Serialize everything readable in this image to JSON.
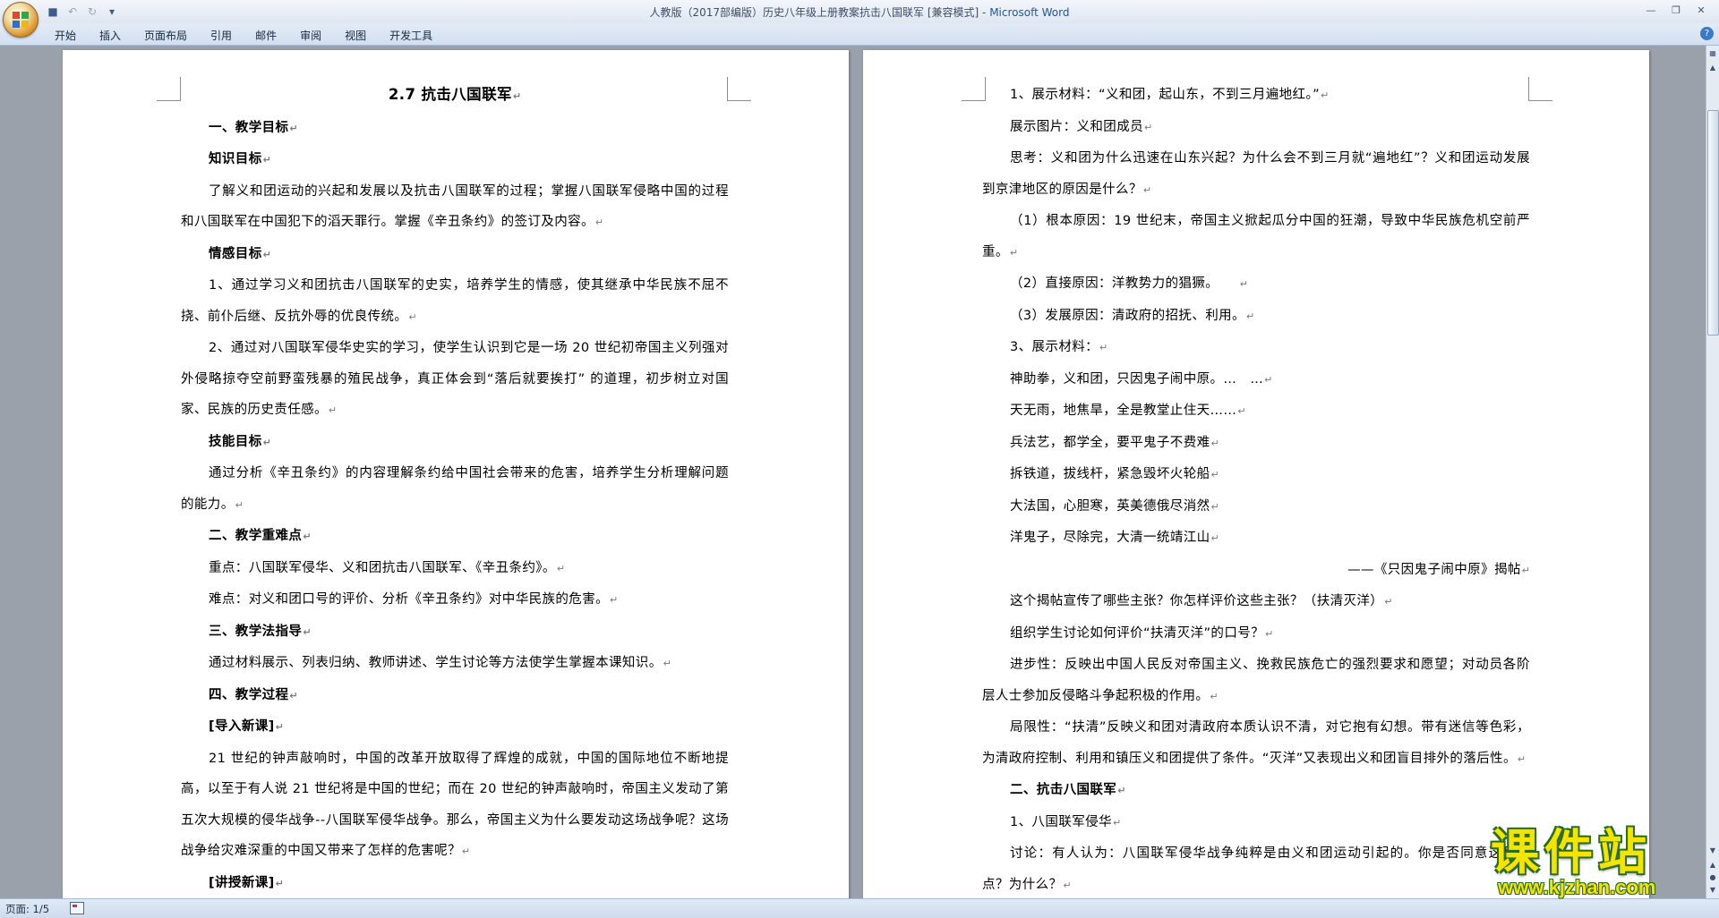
{
  "window": {
    "doc_title": "人教版（2017部编版）历史八年级上册教案抗击八国联军 [兼容模式] - ",
    "app_name": "Microsoft Word"
  },
  "ribbon": {
    "tabs": [
      "开始",
      "插入",
      "页面布局",
      "引用",
      "邮件",
      "审阅",
      "视图",
      "开发工具"
    ]
  },
  "page1": {
    "paragraphs": [
      "2.7 抗击八国联军",
      "一、教学目标",
      "知识目标",
      "了解义和团运动的兴起和发展以及抗击八国联军的过程；掌握八国联军侵略中国的过程和八国联军在中国犯下的滔天罪行。掌握《辛丑条约》的签订及内容。",
      "情感目标",
      "1、通过学习义和团抗击八国联军的史实，培养学生的情感，使其继承中华民族不屈不挠、前仆后继、反抗外辱的优良传统。",
      "2、通过对八国联军侵华史实的学习，使学生认识到它是一场 20 世纪初帝国主义列强对外侵略掠夺空前野蛮残暴的殖民战争，真正体会到“落后就要挨打” 的道理，初步树立对国家、民族的历史责任感。",
      "技能目标",
      "通过分析《辛丑条约》的内容理解条约给中国社会带来的危害，培养学生分析理解问题的能力。",
      "二、教学重难点",
      "重点：八国联军侵华、义和团抗击八国联军、《辛丑条约》。",
      "难点：对义和团口号的评价、分析《辛丑条约》对中华民族的危害。",
      "三、教学法指导",
      "通过材料展示、列表归纳、教师讲述、学生讨论等方法使学生掌握本课知识。",
      "四、教学过程",
      "[导入新课]",
      "21 世纪的钟声敲响时，中国的改革开放取得了辉煌的成就，中国的国际地位不断地提高，以至于有人说 21 世纪将是中国的世纪；而在 20 世纪的钟声敲响时，帝国主义发动了第五次大规模的侵华战争--八国联军侵华战争。那么，帝国主义为什么要发动这场战争呢？这场战争给灾难深重的中国又带来了怎样的危害呢？",
      "[讲授新课]"
    ]
  },
  "page2": {
    "paragraphs": [
      "1、展示材料：“义和团，起山东，不到三月遍地红。”",
      "展示图片：义和团成员",
      "思考：义和团为什么迅速在山东兴起？为什么会不到三月就“遍地红”？义和团运动发展到京津地区的原因是什么？",
      "（1）根本原因：19 世纪末，帝国主义掀起瓜分中国的狂潮，导致中华民族危机空前严重。",
      "（2）直接原因：洋教势力的猖獗。　　",
      "（3）发展原因：清政府的招抚、利用。",
      "3、展示材料：",
      "神助拳，义和团，只因鬼子闹中原。…　…",
      "天无雨，地焦旱，全是教堂止住天……",
      "兵法艺，都学全，要平鬼子不费难",
      "拆铁道，拔线杆，紧急毁坏火轮船",
      "大法国，心胆寒，英美德俄尽消然",
      "洋鬼子，尽除完，大清一统靖江山",
      "——《只因鬼子闹中原》揭帖",
      "这个揭帖宣传了哪些主张？你怎样评价这些主张？（扶清灭洋）",
      "组织学生讨论如何评价“扶清灭洋”的口号？",
      "进步性：反映出中国人民反对帝国主义、挽救民族危亡的强烈要求和愿望；对动员各阶层人士参加反侵略斗争起积极的作用。",
      "局限性：“扶清”反映义和团对清政府本质认识不清，对它抱有幻想。带有迷信等色彩，为清政府控制、利用和镇压义和团提供了条件。“灭洋”又表现出义和团盲目排外的落后性。",
      "二、抗击八国联军",
      "1、八国联军侵华",
      "讨论：有人认为：八国联军侵华战争纯粹是由义和团运动引起的。你是否同意这种观点？为什么？"
    ]
  },
  "status": {
    "page_label": "页面: 1/5"
  },
  "watermark": {
    "name": "课件站",
    "url": "www.kjzhan.com"
  }
}
